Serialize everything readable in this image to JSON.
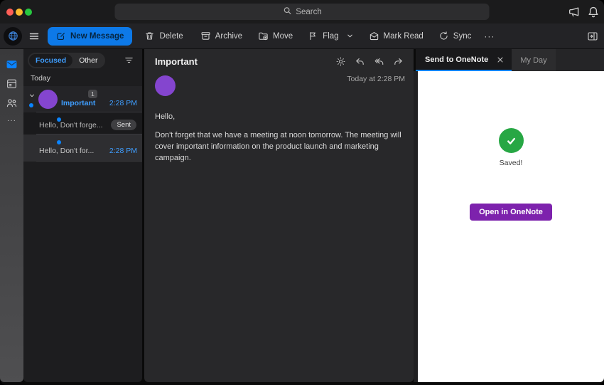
{
  "titlebar": {
    "search_placeholder": "Search"
  },
  "toolbar": {
    "new_message_label": "New Message",
    "delete_label": "Delete",
    "archive_label": "Archive",
    "move_label": "Move",
    "flag_label": "Flag",
    "mark_read_label": "Mark Read",
    "sync_label": "Sync",
    "more_label": "···"
  },
  "sidebar": {
    "more_label": "···"
  },
  "message_list": {
    "tab_focused": "Focused",
    "tab_other": "Other",
    "section_header": "Today",
    "thread": {
      "sender": "Important",
      "time": "2:28 PM",
      "unread_count": "1"
    },
    "messages": [
      {
        "preview": "Hello, Don't forge...",
        "badge": "Sent"
      },
      {
        "preview": "Hello, Don't for...",
        "time": "2:28 PM"
      }
    ]
  },
  "reading_pane": {
    "subject": "Important",
    "timestamp": "Today at 2:28 PM",
    "greeting": "Hello,",
    "body": "Don't forget that we have a meeting at noon tomorrow. The meeting will cover important information on the product launch and marketing campaign."
  },
  "onenote_panel": {
    "tab_label": "Send to OneNote",
    "myday_tab_label": "My Day",
    "status_text": "Saved!",
    "open_button_label": "Open in OneNote"
  },
  "icons": [
    "search-icon",
    "megaphone-icon",
    "bell-icon",
    "globe-avatar-icon",
    "hamburger-icon",
    "compose-icon",
    "trash-icon",
    "archive-icon",
    "move-folder-icon",
    "flag-icon",
    "chevron-down-icon",
    "mark-read-icon",
    "sync-icon",
    "panel-toggle-icon",
    "mail-icon",
    "calendar-icon",
    "people-icon",
    "filter-icon",
    "expand-chevron-icon",
    "brightness-icon",
    "reply-icon",
    "reply-all-icon",
    "forward-icon",
    "close-icon",
    "check-icon"
  ],
  "colors": {
    "accent_blue": "#0a84ff",
    "success_green": "#27a744",
    "onenote_purple": "#7d22ad",
    "avatar_purple": "#8445cf"
  }
}
